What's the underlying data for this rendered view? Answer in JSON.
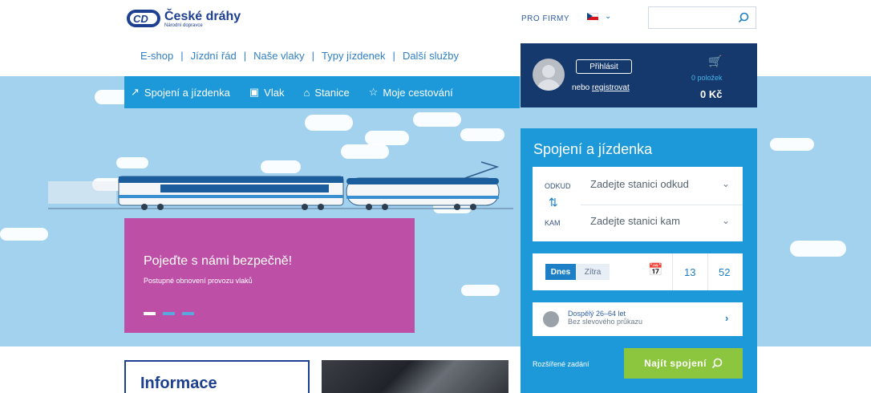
{
  "brand": {
    "name": "České dráhy",
    "sub": "Národní dopravce"
  },
  "header": {
    "pro_firmy": "PRO FIRMY"
  },
  "topnav": [
    "E-shop",
    "Jízdní řád",
    "Naše vlaky",
    "Typy jízdenek",
    "Další služby"
  ],
  "mainnav": [
    "Spojení a jízdenka",
    "Vlak",
    "Stanice",
    "Moje cestování"
  ],
  "user": {
    "login": "Přihlásit",
    "or_text": "nebo ",
    "register": "registrovat"
  },
  "cart": {
    "items": "0 položek",
    "total": "0 Kč"
  },
  "promo": {
    "title": "Pojeďte s námi bezpečně!",
    "subtitle": "Postupné obnovení provozu vlaků"
  },
  "booking": {
    "title": "Spojení a jízdenka",
    "from_label": "ODKUD",
    "from_placeholder": "Zadejte stanici odkud",
    "to_label": "KAM",
    "to_placeholder": "Zadejte stanici kam",
    "today": "Dnes",
    "tomorrow": "Zítra",
    "hour": "13",
    "minute": "52",
    "passenger_type": "Dospělý 26–64 let",
    "passenger_discount": "Bez slevového průkazu",
    "advanced": "Rozšířené zadání",
    "search": "Najít spojení"
  },
  "info": {
    "title": "Informace"
  },
  "colors": {
    "navy": "#15396c",
    "blue": "#1d98d9",
    "pink": "#be4fa7",
    "green": "#8cc63f",
    "sky": "#a3d2ee"
  }
}
